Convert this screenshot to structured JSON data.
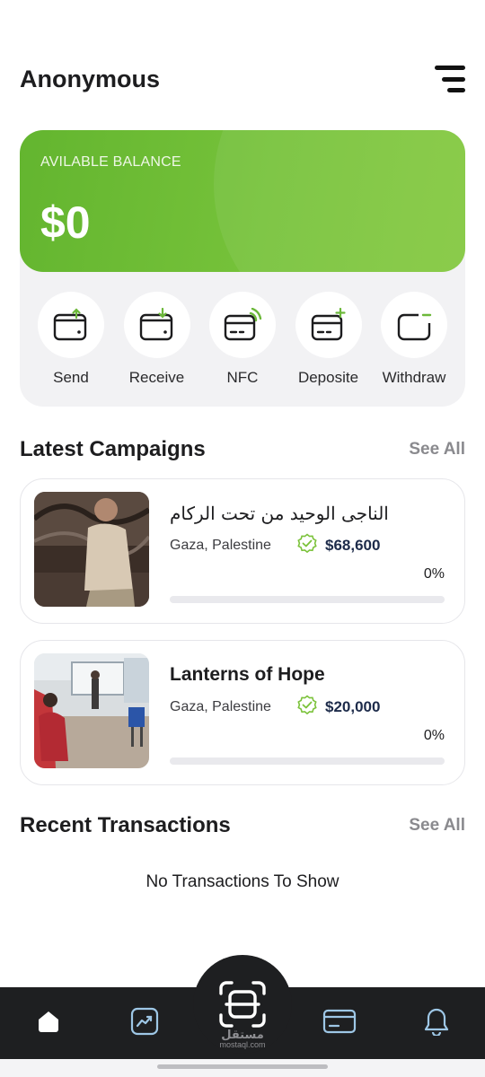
{
  "header": {
    "title": "Anonymous",
    "menu_icon": "hamburger-menu-icon"
  },
  "balance": {
    "label": "AVILABLE BALANCE",
    "value": "$0",
    "accent": "#76c23a"
  },
  "actions": [
    {
      "label": "Send",
      "icon": "wallet-send-icon"
    },
    {
      "label": "Receive",
      "icon": "wallet-receive-icon"
    },
    {
      "label": "NFC",
      "icon": "nfc-card-icon"
    },
    {
      "label": "Deposite",
      "icon": "card-deposit-icon"
    },
    {
      "label": "Withdraw",
      "icon": "wallet-withdraw-icon"
    }
  ],
  "campaigns_section": {
    "title": "Latest Campaigns",
    "see_all": "See All"
  },
  "campaigns": [
    {
      "name": "الناجى الوحيد من تحت الركام",
      "location": "Gaza, Palestine",
      "amount": "$68,600",
      "percent_label": "0%",
      "progress": 0
    },
    {
      "name": "Lanterns of Hope",
      "location": "Gaza, Palestine",
      "amount": "$20,000",
      "percent_label": "0%",
      "progress": 0
    }
  ],
  "transactions_section": {
    "title": "Recent Transactions",
    "see_all": "See All",
    "empty_text": "No Transactions To Show"
  },
  "nav": {
    "items": [
      "home-icon",
      "chart-icon",
      "scan-icon",
      "card-icon",
      "bell-icon"
    ],
    "watermark_arabic": "مستقل",
    "watermark_latin": "mostaql.com"
  }
}
